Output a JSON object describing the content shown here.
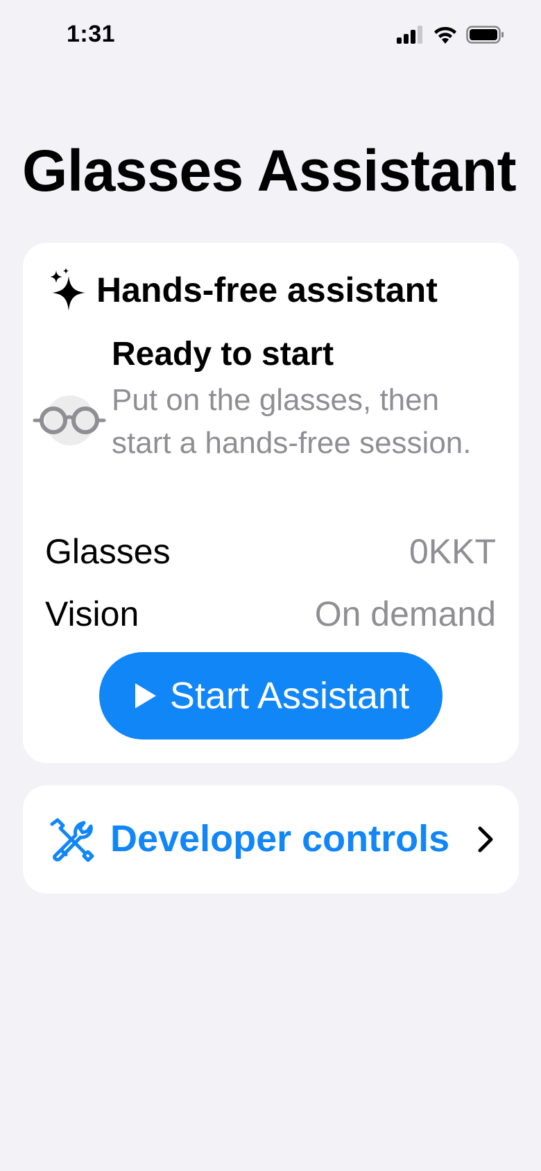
{
  "status_bar": {
    "time": "1:31"
  },
  "page": {
    "title": "Glasses Assistant"
  },
  "assistant_card": {
    "header_title": "Hands-free assistant",
    "header_icon": "sparkles-icon",
    "status_title": "Ready to start",
    "status_description": "Put on the glasses, then start a hands-free session.",
    "status_icon": "glasses-icon",
    "rows": [
      {
        "label": "Glasses",
        "value": "0KKT"
      },
      {
        "label": "Vision",
        "value": "On demand"
      }
    ],
    "start_button_label": "Start Assistant",
    "start_button_icon": "play-icon"
  },
  "developer_card": {
    "label": "Developer controls",
    "icon": "tools-icon",
    "chevron_icon": "chevron-right-icon"
  },
  "colors": {
    "background": "#f2f2f7",
    "card": "#ffffff",
    "accent": "#1186f7",
    "secondary_text": "#8e8e93"
  }
}
